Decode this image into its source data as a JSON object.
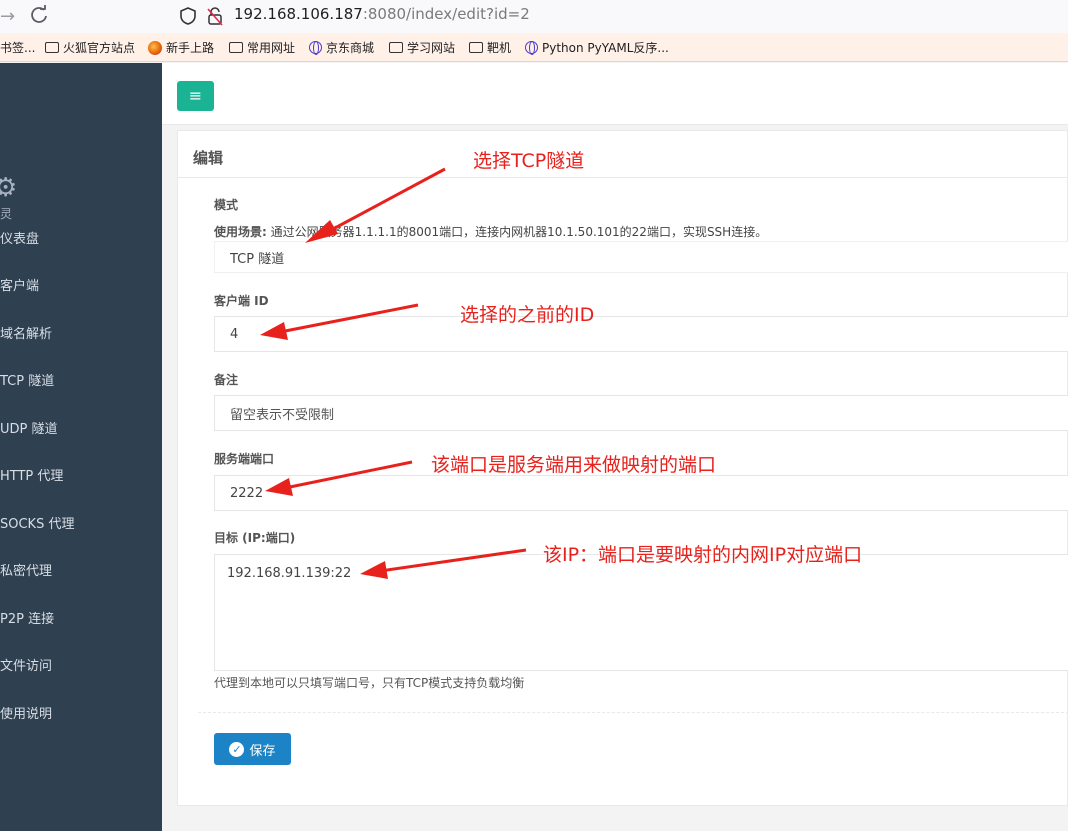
{
  "browser": {
    "nav_forward": "→",
    "url_host": "192.168.106.187",
    "url_rest": ":8080/index/edit?id=2",
    "bookmarks": [
      {
        "label": "书签..."
      },
      {
        "label": "火狐官方站点"
      },
      {
        "label": "新手上路"
      },
      {
        "label": "常用网址"
      },
      {
        "label": "京东商城"
      },
      {
        "label": "学习网站"
      },
      {
        "label": "靶机"
      },
      {
        "label": "Python PyYAML反序..."
      }
    ]
  },
  "sidebar": {
    "brand_fragment": "灵",
    "items": [
      {
        "label": "仪表盘"
      },
      {
        "label": "客户端"
      },
      {
        "label": "域名解析"
      },
      {
        "label": "TCP 隧道"
      },
      {
        "label": "UDP 隧道"
      },
      {
        "label": "HTTP 代理"
      },
      {
        "label": "SOCKS 代理"
      },
      {
        "label": "私密代理"
      },
      {
        "label": "P2P 连接"
      },
      {
        "label": "文件访问"
      },
      {
        "label": "使用说明"
      }
    ]
  },
  "header": {
    "menu_glyph": "≡"
  },
  "form": {
    "title": "编辑",
    "mode_label": "模式",
    "usage_prefix": "使用场景:",
    "usage_text": " 通过公网服务器1.1.1.1的8001端口，连接内网机器10.1.50.101的22端口，实现SSH连接。",
    "mode_value": "TCP 隧道",
    "client_id_label": "客户端 ID",
    "client_id_value": "4",
    "remark_label": "备注",
    "remark_placeholder": "留空表示不受限制",
    "server_port_label": "服务端端口",
    "server_port_value": "2222",
    "target_label": "目标 (IP:端口)",
    "target_value": "192.168.91.139:22",
    "target_help": "代理到本地可以只填写端口号，只有TCP模式支持负载均衡",
    "save_label": "保存"
  },
  "annotations": {
    "mode_note": "选择TCP隧道",
    "id_note": "选择的之前的ID",
    "port_note": "该端口是服务端用来做映射的端口",
    "target_note": "该IP：端口是要映射的内网IP对应端口"
  },
  "colors": {
    "sidebar_bg": "#2f4050",
    "menu_button": "#1ab394",
    "save_button": "#1c84c6",
    "annotation_red": "#e8211c"
  }
}
